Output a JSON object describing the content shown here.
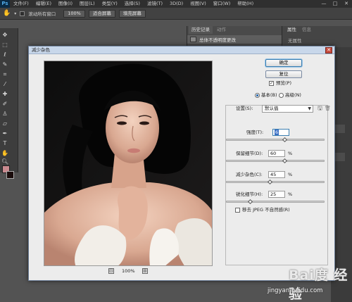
{
  "menubar": {
    "logo": "Ps",
    "items": [
      "文件(F)",
      "编辑(E)",
      "图像(I)",
      "图层(L)",
      "类型(Y)",
      "选择(S)",
      "滤镜(T)",
      "3D(D)",
      "视图(V)",
      "窗口(W)",
      "帮助(H)"
    ],
    "minimize": "—",
    "maximize": "□",
    "close": "✕"
  },
  "options": {
    "scroll_all_label": "滚动所有窗口",
    "zoom_100": "100%",
    "fit_screen": "适合屏幕",
    "fill_screen": "填充屏幕"
  },
  "panels": {
    "history_tab": "历史记录",
    "actions_tab": "动作",
    "history_item": "总体不透明度更改",
    "properties_tab": "属性",
    "info_tab": "信息",
    "properties_empty": "无属性"
  },
  "dialog": {
    "title": "减少杂色",
    "close": "✕",
    "ok": "确定",
    "reset": "复位",
    "preview_label": "预览(P)",
    "mode_basic": "基本(B)",
    "mode_advanced": "高级(N)",
    "settings_label": "设置(S):",
    "settings_value": "默认值",
    "zoom": "100%",
    "zoom_minus": "⊟",
    "zoom_plus": "⊞",
    "strength_label": "强度(T):",
    "strength_value": "6",
    "preserve_label": "保留细节(D):",
    "preserve_value": "60",
    "reduce_label": "减少杂色(C):",
    "reduce_value": "45",
    "sharpen_label": "锐化细节(H):",
    "sharpen_value": "25",
    "percent": "%",
    "jpeg_label": "移去 JPEG 不自然感(R)",
    "preview_checked": true,
    "jpeg_checked": false,
    "mode": "basic"
  },
  "sliders": {
    "strength": 0.6,
    "preserve": 0.6,
    "reduce": 0.45,
    "sharpen": 0.25
  },
  "watermark": {
    "logo": "Bai度 经验",
    "url": "jingyan.baidu.com"
  },
  "colors": {
    "foreground": "#c98a8f",
    "background": "#1a0c0c",
    "accent": "#3c7fb1"
  }
}
